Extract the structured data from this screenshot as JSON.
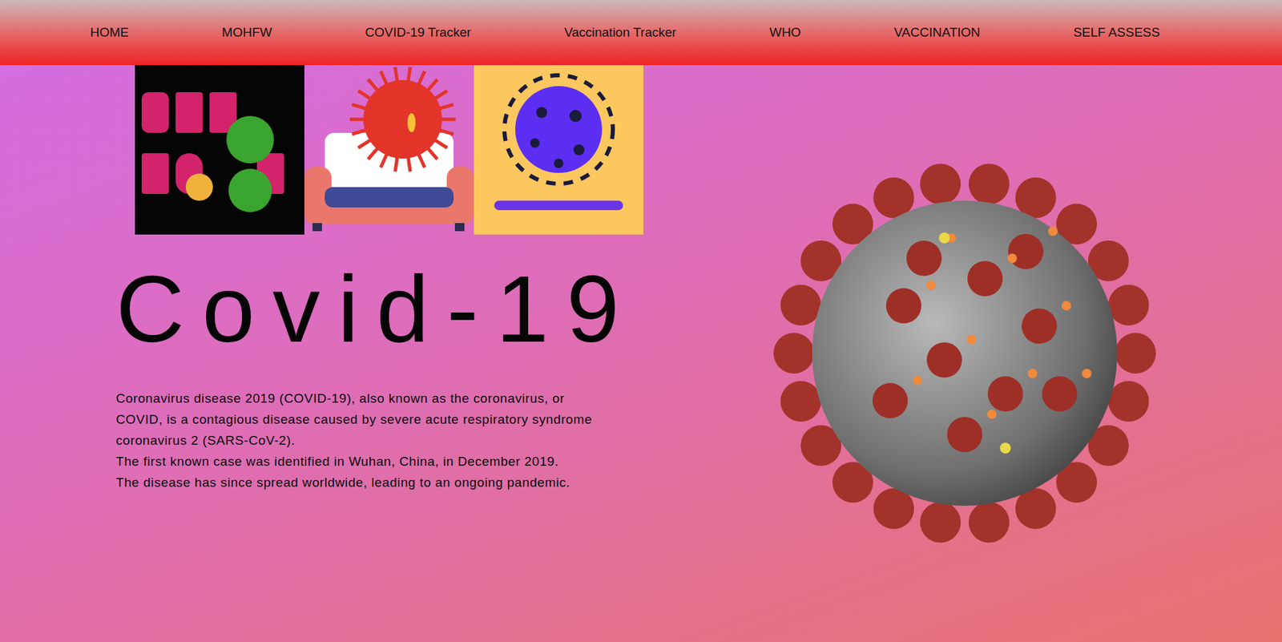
{
  "navbar": {
    "items": [
      {
        "label": "HOME"
      },
      {
        "label": "MOHFW"
      },
      {
        "label": "COVID-19 Tracker"
      },
      {
        "label": "Vaccination Tracker"
      },
      {
        "label": "WHO"
      },
      {
        "label": "VACCINATION"
      },
      {
        "label": "SELF ASSESS"
      }
    ]
  },
  "stickers": [
    {
      "name": "stay-home-sticker"
    },
    {
      "name": "virus-on-couch-sticker"
    },
    {
      "name": "wash-hands-sticker"
    }
  ],
  "hero": {
    "title": "Covid-19",
    "description": [
      "Coronavirus disease 2019 (COVID-19), also known as the coronavirus, or",
      "COVID, is a contagious disease caused by severe acute respiratory syndrome",
      "coronavirus 2 (SARS-CoV-2).",
      "The first known case was identified in Wuhan, China, in December 2019.",
      "The disease has since spread worldwide, leading to an ongoing pandemic."
    ]
  },
  "image": {
    "name": "coronavirus-image"
  }
}
